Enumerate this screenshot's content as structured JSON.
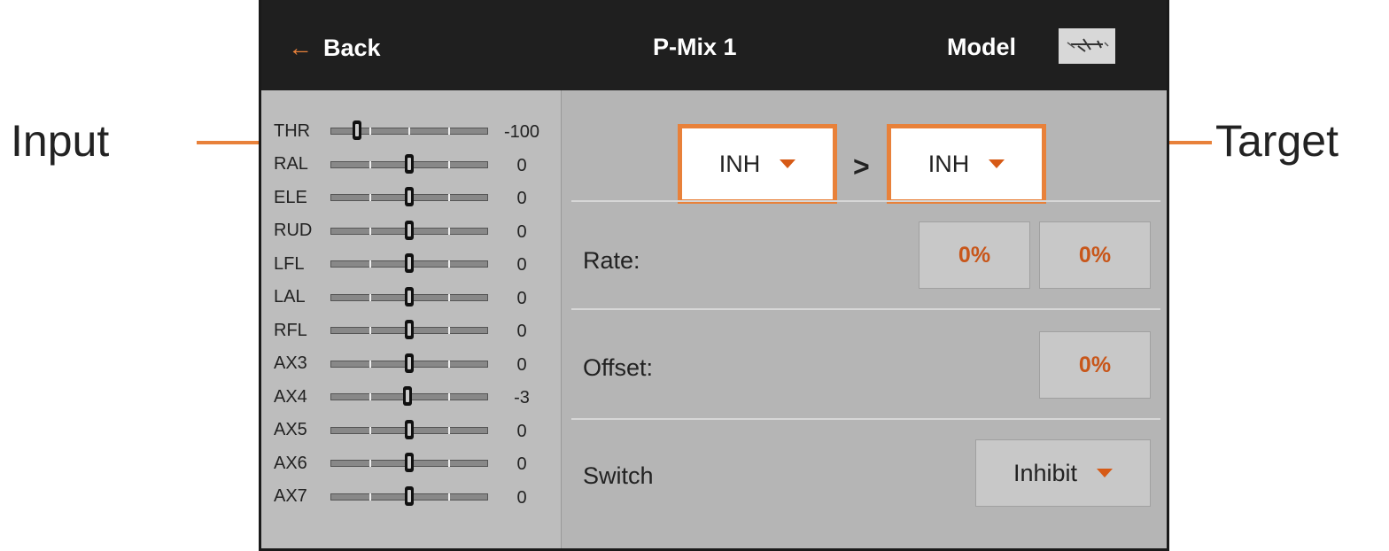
{
  "callouts": {
    "input": "Input",
    "target": "Target",
    "color": "#e8813a"
  },
  "header": {
    "back_label": "Back",
    "title": "P-Mix 1",
    "model_label": "Model"
  },
  "channels": [
    {
      "name": "THR",
      "value": "-100",
      "position": -100
    },
    {
      "name": "RAL",
      "value": "0",
      "position": 0
    },
    {
      "name": "ELE",
      "value": "0",
      "position": 0
    },
    {
      "name": "RUD",
      "value": "0",
      "position": 0
    },
    {
      "name": "LFL",
      "value": "0",
      "position": 0
    },
    {
      "name": "LAL",
      "value": "0",
      "position": 0
    },
    {
      "name": "RFL",
      "value": "0",
      "position": 0
    },
    {
      "name": "AX3",
      "value": "0",
      "position": 0
    },
    {
      "name": "AX4",
      "value": "-3",
      "position": -3
    },
    {
      "name": "AX5",
      "value": "0",
      "position": 0
    },
    {
      "name": "AX6",
      "value": "0",
      "position": 0
    },
    {
      "name": "AX7",
      "value": "0",
      "position": 0
    }
  ],
  "mix": {
    "input_value": "INH",
    "separator": ">",
    "target_value": "INH",
    "rate_label": "Rate:",
    "rate_low": "0%",
    "rate_high": "0%",
    "offset_label": "Offset:",
    "offset_value": "0%",
    "switch_label": "Switch",
    "switch_value": "Inhibit"
  }
}
